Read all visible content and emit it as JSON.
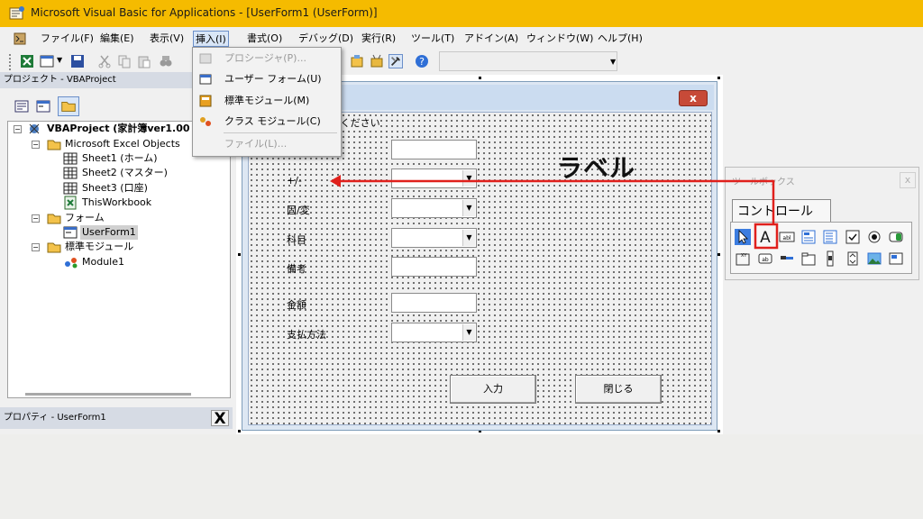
{
  "window": {
    "title": "Microsoft Visual Basic for Applications - [UserForm1 (UserForm)]"
  },
  "menu": [
    {
      "label": "ファイル(F)"
    },
    {
      "label": "編集(E)"
    },
    {
      "label": "表示(V)"
    },
    {
      "label": "挿入(I)"
    },
    {
      "label": "書式(O)"
    },
    {
      "label": "デバッグ(D)"
    },
    {
      "label": "実行(R)"
    },
    {
      "label": "ツール(T)"
    },
    {
      "label": "アドイン(A)"
    },
    {
      "label": "ウィンドウ(W)"
    },
    {
      "label": "ヘルプ(H)"
    }
  ],
  "insert_menu": [
    {
      "label": "プロシージャ(P)...",
      "enabled": false
    },
    {
      "label": "ユーザー フォーム(U)",
      "enabled": true
    },
    {
      "label": "標準モジュール(M)",
      "enabled": true
    },
    {
      "label": "クラス モジュール(C)",
      "enabled": true
    },
    {
      "label": "ファイル(L)...",
      "enabled": false
    }
  ],
  "project_panel": {
    "title": "プロジェクト - VBAProject"
  },
  "tree": [
    {
      "label": "VBAProject (家計簿ver1.00"
    },
    {
      "label": "Microsoft Excel Objects"
    },
    {
      "label": "Sheet1 (ホーム)"
    },
    {
      "label": "Sheet2 (マスター)"
    },
    {
      "label": "Sheet3 (口座)"
    },
    {
      "label": "ThisWorkbook"
    },
    {
      "label": "フォーム"
    },
    {
      "label": "UserForm1"
    },
    {
      "label": "標準モジュール"
    },
    {
      "label": "Module1"
    }
  ],
  "properties_panel": {
    "title": "プロパティ - UserForm1",
    "close": "X"
  },
  "form": {
    "close": "x",
    "instruction": "てください",
    "labels": [
      "+/-",
      "固/変",
      "科目",
      "備考",
      "金額",
      "支払方法"
    ],
    "buttons": {
      "enter": "入力",
      "close": "閉じる"
    }
  },
  "toolbox": {
    "title": "ツールボックス",
    "close": "x",
    "tab": "コントロール"
  },
  "annotation": {
    "text": "ラベル",
    "color": "#e0201c"
  }
}
